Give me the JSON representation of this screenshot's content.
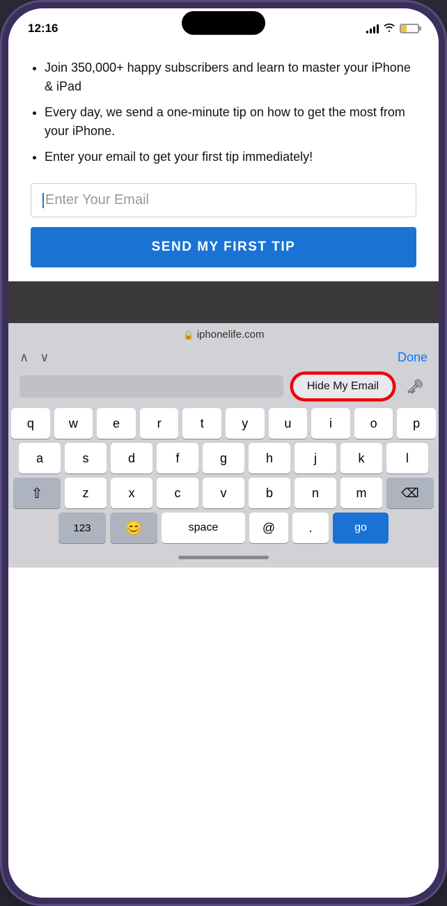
{
  "statusBar": {
    "time": "12:16",
    "battery_alt": "battery"
  },
  "webPage": {
    "bullets": [
      "Join 350,000+ happy subscribers and learn to master your iPhone & iPad",
      "Every day, we send a one-minute tip on how to get the most from your iPhone.",
      "Enter your email to get your first tip immediately!"
    ],
    "emailInput": {
      "placeholder": "Enter Your Email",
      "value": ""
    },
    "submitButton": "SEND MY FIRST TIP"
  },
  "safariBar": {
    "domain": "iphonelife.com",
    "lock": "🔒"
  },
  "keyboardNav": {
    "done": "Done"
  },
  "autocomplete": {
    "hideMyEmail": "Hide My Email",
    "keyIcon": "🗝"
  },
  "keyboard": {
    "rows": [
      [
        "q",
        "w",
        "e",
        "r",
        "t",
        "y",
        "u",
        "i",
        "o",
        "p"
      ],
      [
        "a",
        "s",
        "d",
        "f",
        "g",
        "h",
        "j",
        "k",
        "l"
      ],
      [
        "⇧",
        "z",
        "x",
        "c",
        "v",
        "b",
        "n",
        "m",
        "⌫"
      ],
      [
        "123",
        "😊",
        "space",
        "@",
        ".",
        "go"
      ]
    ]
  },
  "homeBar": {}
}
